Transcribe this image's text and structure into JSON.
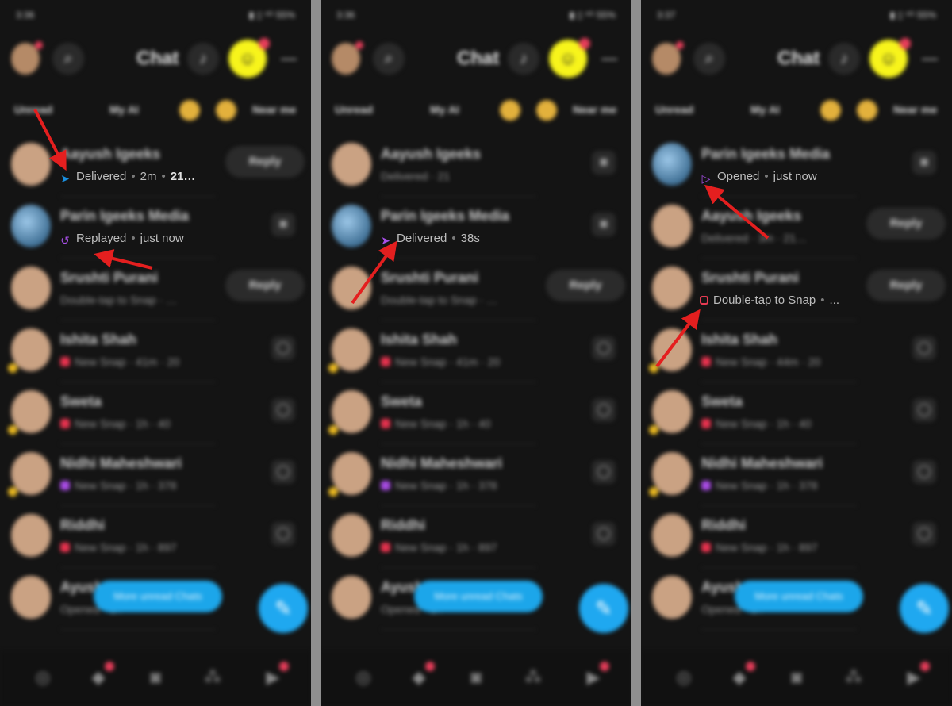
{
  "panels": [
    {
      "status": {
        "time": "3:36",
        "system": "▮ ▯ ⁹ᴳ 55%"
      },
      "header": {
        "title": "Chat"
      },
      "filters": {
        "unread": "Unread",
        "my_ai": "My AI",
        "near_me": "Near me"
      },
      "rows": [
        {
          "name": "Aayush Igeeks",
          "sub": "Delivered · 2m · 21…",
          "kind": "reply",
          "av": "person",
          "streak": false
        },
        {
          "name": "Parin Igeeks Media",
          "sub": "Replayed · just now",
          "kind": "camera",
          "av": "photo",
          "streak": false
        },
        {
          "name": "Srushti Purani",
          "sub": "Double-tap to Snap · …",
          "kind": "reply",
          "av": "person",
          "streak": false
        },
        {
          "name": "Ishita Shah",
          "sub": "New Snap · 41m · 20",
          "kind": "chat",
          "av": "person",
          "streak": true,
          "mark": "red"
        },
        {
          "name": "Sweta",
          "sub": "New Snap · 1h · 40",
          "kind": "chat",
          "av": "person",
          "streak": true,
          "mark": "red"
        },
        {
          "name": "Nidhi Maheshwari",
          "sub": "New Snap · 1h · 378",
          "kind": "chat",
          "av": "person",
          "streak": true,
          "mark": "purple"
        },
        {
          "name": "Riddhi",
          "sub": "New Snap · 1h · 897",
          "kind": "chat",
          "av": "person",
          "streak": false,
          "mark": "red"
        },
        {
          "name": "Ayush",
          "sub": "Opened · 1h",
          "kind": "camera",
          "av": "person",
          "streak": false
        }
      ],
      "more_unread": "More unread Chats",
      "highlights": [
        {
          "row": 0,
          "icon": "➤",
          "icon_color": "blue",
          "status": "Delivered",
          "sep1": "•",
          "time": "2m",
          "sep2": "•",
          "extra": "21…"
        },
        {
          "row": 1,
          "icon": "↺",
          "icon_color": "purple",
          "status": "Replayed",
          "sep1": "•",
          "time": "just now"
        }
      ]
    },
    {
      "status": {
        "time": "3:36",
        "system": "▮ ▯ ⁹ᴳ 55%"
      },
      "header": {
        "title": "Chat"
      },
      "filters": {
        "unread": "Unread",
        "my_ai": "My AI",
        "near_me": "Near me"
      },
      "rows": [
        {
          "name": "Aayush Igeeks",
          "sub": "Delivered · 21",
          "kind": "camera",
          "av": "person",
          "streak": false
        },
        {
          "name": "Parin Igeeks Media",
          "sub": "Delivered · 38s",
          "kind": "camera",
          "av": "photo",
          "streak": false
        },
        {
          "name": "Srushti Purani",
          "sub": "Double-tap to Snap · …",
          "kind": "reply",
          "av": "person",
          "streak": false
        },
        {
          "name": "Ishita Shah",
          "sub": "New Snap · 41m · 20",
          "kind": "chat",
          "av": "person",
          "streak": true,
          "mark": "red"
        },
        {
          "name": "Sweta",
          "sub": "New Snap · 1h · 40",
          "kind": "chat",
          "av": "person",
          "streak": true,
          "mark": "red"
        },
        {
          "name": "Nidhi Maheshwari",
          "sub": "New Snap · 1h · 378",
          "kind": "chat",
          "av": "person",
          "streak": true,
          "mark": "purple"
        },
        {
          "name": "Riddhi",
          "sub": "New Snap · 1h · 897",
          "kind": "chat",
          "av": "person",
          "streak": false,
          "mark": "red"
        },
        {
          "name": "Ayush",
          "sub": "Opened · 1h",
          "kind": "camera",
          "av": "person",
          "streak": false
        }
      ],
      "more_unread": "More unread Chats",
      "highlights": [
        {
          "row": 1,
          "icon": "➤",
          "icon_color": "purple",
          "status": "Delivered",
          "sep1": "•",
          "time": "38s"
        }
      ]
    },
    {
      "status": {
        "time": "3:37",
        "system": "▮ ▯ ⁹ᴳ 55%"
      },
      "header": {
        "title": "Chat"
      },
      "filters": {
        "unread": "Unread",
        "my_ai": "My AI",
        "near_me": "Near me"
      },
      "rows": [
        {
          "name": "Parin Igeeks Media",
          "sub": "Opened · just now",
          "kind": "camera",
          "av": "photo",
          "streak": false
        },
        {
          "name": "Aayush Igeeks",
          "sub": "Delivered · 3m · 21…",
          "kind": "reply",
          "av": "person",
          "streak": false
        },
        {
          "name": "Srushti Purani",
          "sub": "Double-tap to Snap · …",
          "kind": "reply",
          "av": "person",
          "streak": false
        },
        {
          "name": "Ishita Shah",
          "sub": "New Snap · 44m · 20",
          "kind": "chat",
          "av": "person",
          "streak": true,
          "mark": "red"
        },
        {
          "name": "Sweta",
          "sub": "New Snap · 1h · 40",
          "kind": "chat",
          "av": "person",
          "streak": true,
          "mark": "red"
        },
        {
          "name": "Nidhi Maheshwari",
          "sub": "New Snap · 1h · 378",
          "kind": "chat",
          "av": "person",
          "streak": true,
          "mark": "purple"
        },
        {
          "name": "Riddhi",
          "sub": "New Snap · 1h · 897",
          "kind": "chat",
          "av": "person",
          "streak": false,
          "mark": "red"
        },
        {
          "name": "Ayush",
          "sub": "Opened · 1h",
          "kind": "camera",
          "av": "person",
          "streak": false
        }
      ],
      "more_unread": "More unread Chats",
      "highlights": [
        {
          "row": 0,
          "icon": "▷",
          "icon_color": "purple",
          "status": "Opened",
          "sep1": "•",
          "time": "just now"
        },
        {
          "row": 2,
          "icon": "□",
          "icon_color": "red",
          "status": "Double-tap to Snap",
          "sep1": "•",
          "time": "..."
        }
      ]
    }
  ],
  "icons": {
    "camera": "camera-icon",
    "chat": "chat-bubble-icon",
    "reply": "reply-icon",
    "search": "search-icon",
    "more": "more-icon",
    "add_friend": "add-friend-icon",
    "compose": "new-chat-icon"
  },
  "colors": {
    "accent_blue": "#1ca6ea",
    "snap_yellow": "#f7f41b",
    "delivered_blue": "#1a8fe0",
    "snap_purple": "#a64ee6",
    "snap_red": "#e63b53",
    "arrow_red": "#e41f1f"
  }
}
